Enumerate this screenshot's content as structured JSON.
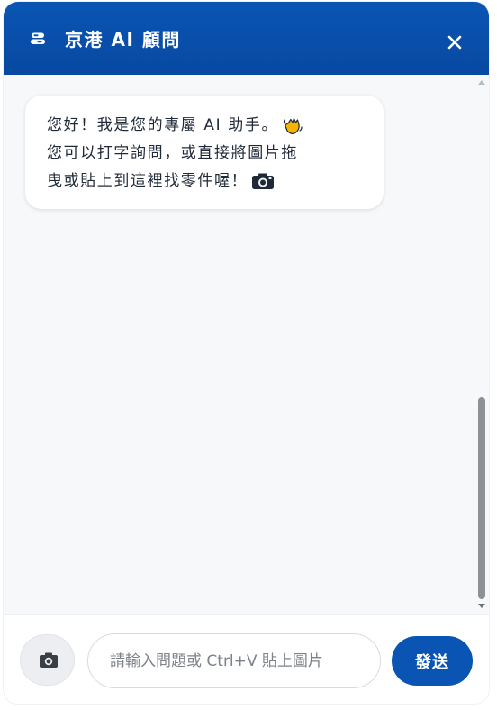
{
  "header": {
    "icon": "robot-icon",
    "title": "京港 AI 顧問",
    "close_icon": "close-icon"
  },
  "messages": [
    {
      "sender": "assistant",
      "lines": [
        "您好！我是您的專屬 AI 助手。",
        "您可以打字詢問，或直接將圖片拖",
        "曳或貼上到這裡找零件喔！"
      ],
      "emojis": [
        "waving-hand-icon",
        "camera-icon"
      ]
    }
  ],
  "composer": {
    "camera_icon": "camera-icon",
    "input_value": "",
    "input_placeholder": "請輸入問題或 Ctrl+V 貼上圖片",
    "send_label": "發送"
  },
  "colors": {
    "header_bg": "#0a55b4",
    "chat_bg": "#f6f8fa",
    "send_button": "#0a55b4",
    "bubble_bg": "#ffffff"
  }
}
